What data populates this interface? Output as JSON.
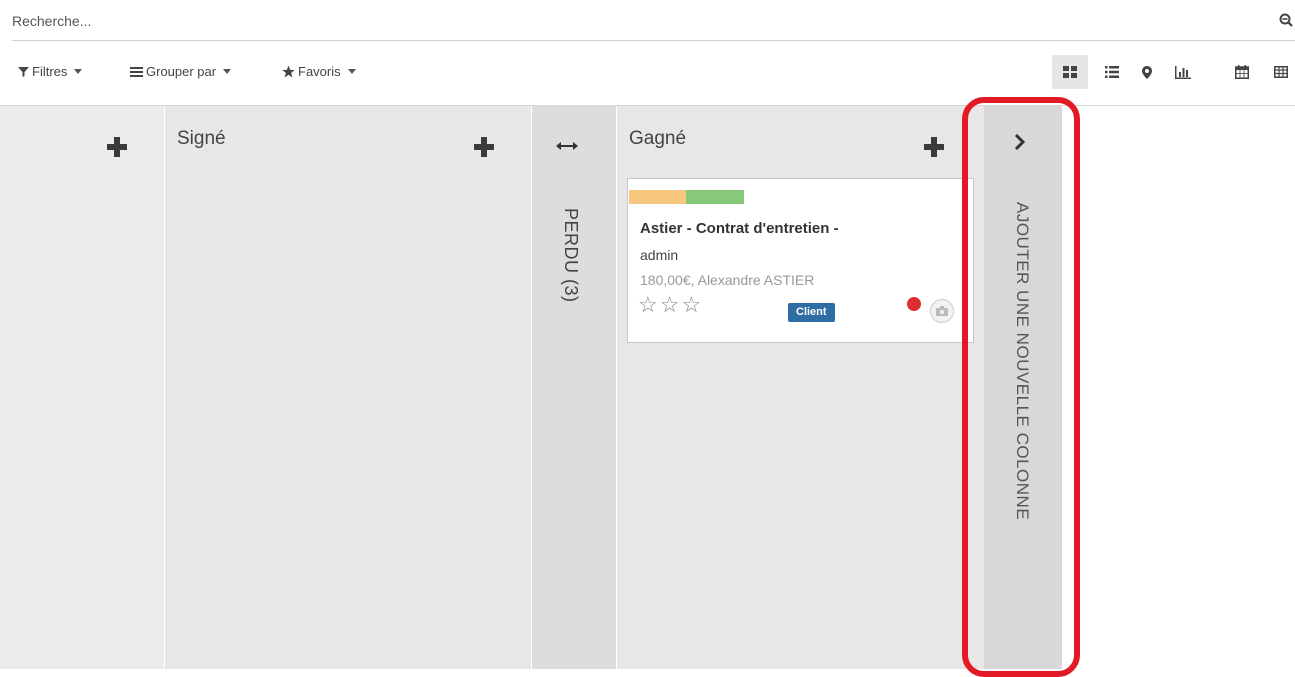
{
  "search": {
    "placeholder": "Recherche..."
  },
  "toolbar": {
    "filters_label": "Filtres",
    "group_by_label": "Grouper par",
    "favorites_label": "Favoris",
    "views": [
      {
        "name": "kanban",
        "icon": "kanban-icon",
        "active": true
      },
      {
        "name": "list",
        "icon": "list-icon",
        "active": false
      },
      {
        "name": "map",
        "icon": "map-marker-icon",
        "active": false
      },
      {
        "name": "graph",
        "icon": "bar-chart-icon",
        "active": false
      },
      {
        "name": "calendar",
        "icon": "calendar-icon",
        "active": false
      },
      {
        "name": "pivot",
        "icon": "table-icon",
        "active": false
      }
    ]
  },
  "columns": [
    {
      "title": "Signé"
    },
    {
      "title": "Gagné"
    }
  ],
  "folded_column": {
    "label": "PERDU (3)"
  },
  "add_column": {
    "label": "AJOUTER UNE NOUVELLE COLONNE"
  },
  "card": {
    "title": "Astier - Contrat d'entretien -",
    "subtitle": "admin",
    "meta": "180,00€, Alexandre ASTIER",
    "tag": "Client",
    "stars": 0,
    "status_color": "#dc2f2f",
    "tag_colors": [
      "#f7c77f",
      "#86c97a"
    ]
  },
  "colors": {
    "highlight": "#e21a26",
    "badge": "#2e6ca4"
  }
}
